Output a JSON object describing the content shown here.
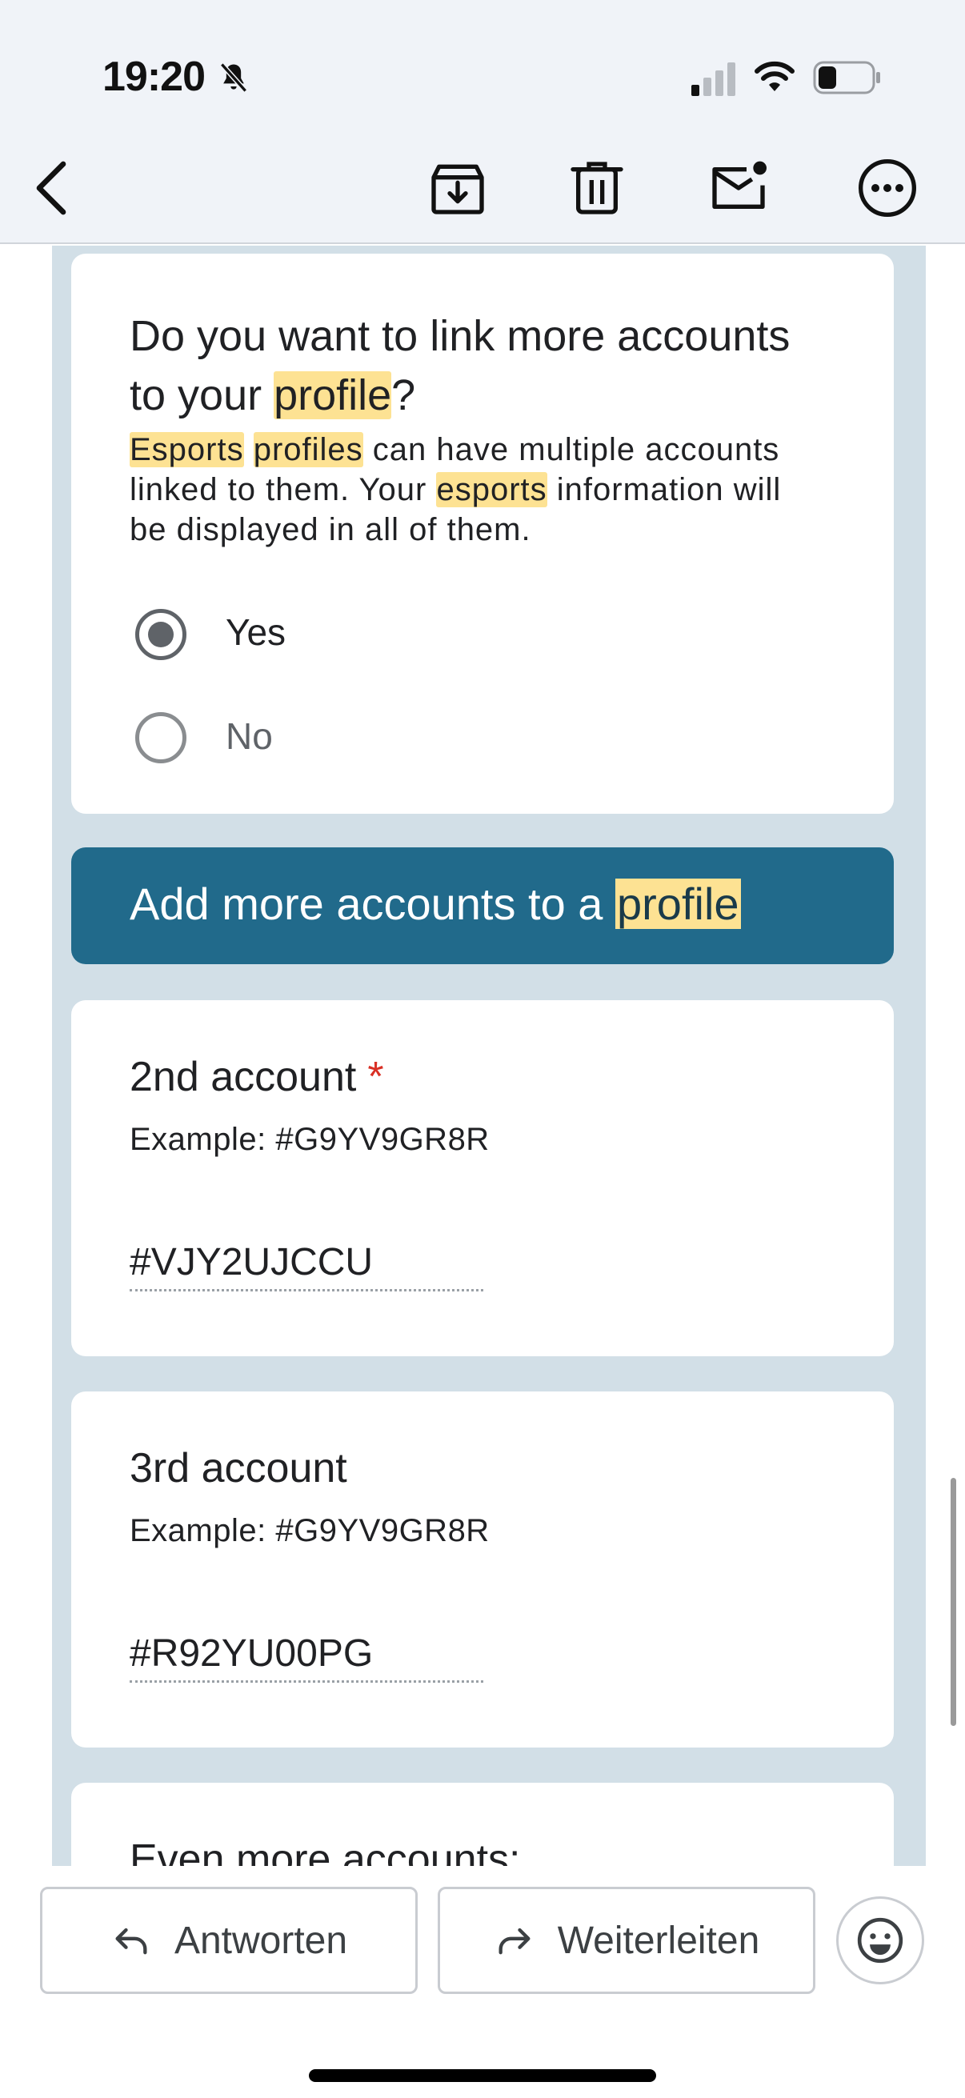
{
  "status_bar": {
    "time": "19:20"
  },
  "toolbar": {
    "back": "back",
    "archive": "archive",
    "delete": "delete",
    "mark_unread": "mark unread",
    "more": "more"
  },
  "question": {
    "title_part1": "Do you want to link more accounts",
    "title_part2": "to your ",
    "title_hl": "profile",
    "title_end": "?",
    "desc_hl1": "Esports",
    "desc_hl2": "profiles",
    "desc_part1": " can have multiple accounts",
    "desc_part2": "linked to them. Your ",
    "desc_hl3": "esports",
    "desc_part3": " information will",
    "desc_part4": "be displayed in all of them.",
    "options": [
      {
        "label": "Yes",
        "selected": true
      },
      {
        "label": "No",
        "selected": false
      }
    ]
  },
  "section": {
    "title": "Add more accounts to a ",
    "title_hl": "profile"
  },
  "fields": [
    {
      "title": "2nd account",
      "required_mark": "*",
      "example": "Example: #G9YV9GR8R",
      "value": "#VJY2UJCCU"
    },
    {
      "title": "3rd account",
      "example": "Example: #G9YV9GR8R",
      "value": "#R92YU00PG"
    },
    {
      "title": "Even more accounts:"
    }
  ],
  "bottom": {
    "reply": "Antworten",
    "forward": "Weiterleiten"
  },
  "colors": {
    "section_header": "#216a8b",
    "highlight": "#fde293",
    "form_background": "#d2dfe7",
    "required": "#d93025"
  }
}
